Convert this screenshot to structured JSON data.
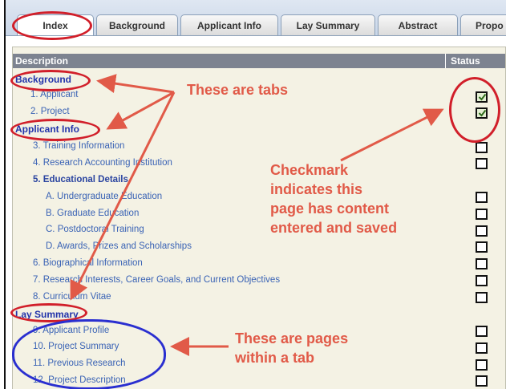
{
  "tabs": [
    {
      "label": "Index",
      "active": true
    },
    {
      "label": "Background"
    },
    {
      "label": "Applicant Info"
    },
    {
      "label": "Lay Summary"
    },
    {
      "label": "Abstract"
    },
    {
      "label": "Propo"
    }
  ],
  "table": {
    "col_description": "Description",
    "col_status": "Status"
  },
  "sections": {
    "background": "Background",
    "applicant_info": "Applicant Info",
    "lay_summary": "Lay Summary"
  },
  "items": [
    {
      "label": "1. Applicant",
      "checked": true
    },
    {
      "label": "2. Project",
      "checked": true
    },
    {
      "label": "3. Training Information",
      "checked": false
    },
    {
      "label": "4. Research Accounting Institution",
      "checked": false
    },
    {
      "label": "5. Educational Details",
      "checked": null
    },
    {
      "label": "A. Undergraduate Education",
      "checked": false
    },
    {
      "label": "B. Graduate Education",
      "checked": false
    },
    {
      "label": "C. Postdoctoral Training",
      "checked": false
    },
    {
      "label": "D. Awards, Prizes and Scholarships",
      "checked": false
    },
    {
      "label": "6. Biographical Information",
      "checked": false
    },
    {
      "label": "7. Research Interests, Career Goals, and Current Objectives",
      "checked": false
    },
    {
      "label": "8. Curriculum Vitae",
      "checked": false
    },
    {
      "label": "9. Applicant Profile",
      "checked": false
    },
    {
      "label": "10. Project Summary",
      "checked": false
    },
    {
      "label": "11. Previous Research",
      "checked": false
    },
    {
      "label": "12. Project Description",
      "checked": false
    }
  ],
  "annotations": {
    "tabs_note": "These are tabs",
    "checkmark_note": [
      "Checkmark",
      "indicates this",
      "page has content",
      "entered and saved"
    ],
    "pages_note": [
      "These are pages",
      "within a tab"
    ],
    "red": "#d11f2a",
    "blue": "#2a2fd0",
    "arrow": "#e15a48"
  }
}
